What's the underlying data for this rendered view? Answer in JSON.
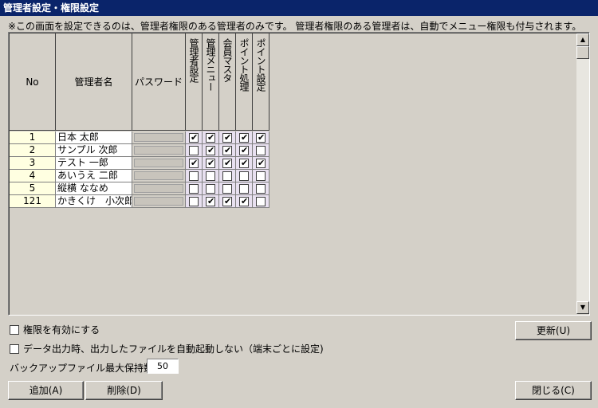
{
  "window": {
    "title": "管理者設定・権限設定"
  },
  "notice": "※この画面を設定できるのは、管理者権限のある管理者のみです。 管理者権限のある管理者は、自動でメニュー権限も付与されます。",
  "table": {
    "headers": {
      "no": "No",
      "name": "管理者名",
      "password": "パスワード",
      "perm_admin": "管理者設定",
      "perm_menu": "管理メニュー",
      "perm_member": "会員マスタ",
      "perm_point_proc": "ポイント処理",
      "perm_point_set": "ポイント設定"
    },
    "rows": [
      {
        "no": "1",
        "name": "日本 太郎",
        "perms": [
          true,
          true,
          true,
          true,
          true
        ]
      },
      {
        "no": "2",
        "name": "サンプル 次郎",
        "perms": [
          false,
          true,
          true,
          true,
          false
        ]
      },
      {
        "no": "3",
        "name": "テスト 一郎",
        "perms": [
          true,
          true,
          true,
          true,
          true
        ]
      },
      {
        "no": "4",
        "name": "あいうえ 二郎",
        "perms": [
          false,
          false,
          false,
          false,
          false
        ]
      },
      {
        "no": "5",
        "name": "縦横 ななめ",
        "perms": [
          false,
          false,
          false,
          false,
          false
        ]
      },
      {
        "no": "121",
        "name": "かきくけ　小次郎",
        "perms": [
          false,
          true,
          true,
          true,
          false
        ]
      }
    ]
  },
  "options": {
    "enable_perm": {
      "label": "権限を有効にする",
      "checked": false
    },
    "no_autostart": {
      "label": "データ出力時、出力したファイルを自動起動しない（端末ごとに設定)",
      "checked": false
    },
    "backup_label": "バックアップファイル最大保持数",
    "backup_value": "50"
  },
  "buttons": {
    "update": "更新(U)",
    "add": "追加(A)",
    "delete": "削除(D)",
    "close": "閉じる(C)"
  },
  "icons": {
    "check": "✔",
    "scroll_up": "▲",
    "scroll_down": "▼"
  }
}
